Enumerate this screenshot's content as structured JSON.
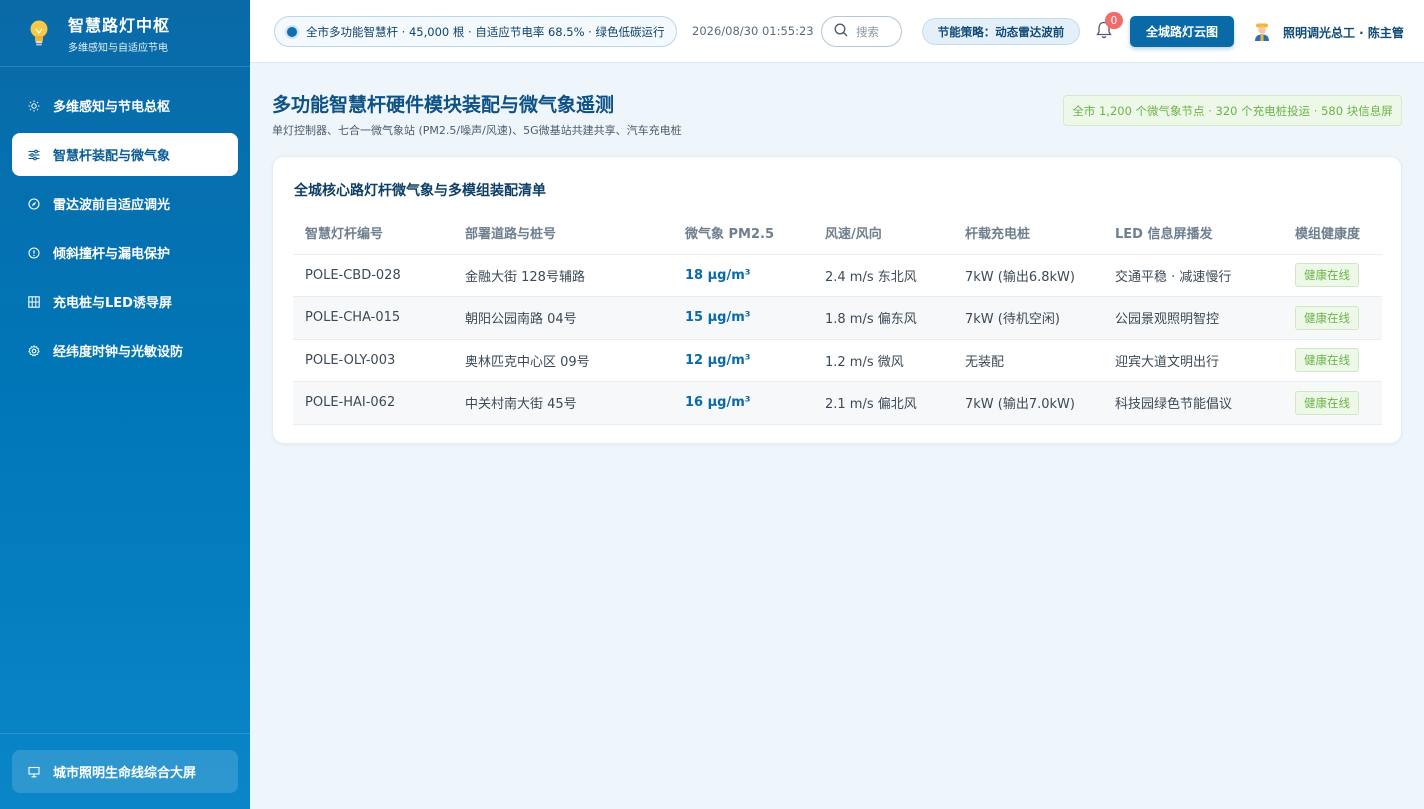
{
  "sidebar": {
    "brand_title": "智慧路灯中枢",
    "brand_subtitle": "多维感知与自适应节电",
    "items": [
      {
        "label": "多维感知与节电总枢",
        "icon": "sun-icon"
      },
      {
        "label": "智慧杆装配与微气象",
        "icon": "sliders-icon",
        "active": true
      },
      {
        "label": "雷达波前自适应调光",
        "icon": "compass-icon"
      },
      {
        "label": "倾斜撞杆与漏电保护",
        "icon": "alert-circle-icon"
      },
      {
        "label": "充电桩与LED诱导屏",
        "icon": "grid-icon"
      },
      {
        "label": "经纬度时钟与光敏设防",
        "icon": "gear-icon"
      }
    ],
    "footer_label": "城市照明生命线综合大屏"
  },
  "header": {
    "ticker": "全市多功能智慧杆 · 45,000 根 · 自适应节电率 68.5% · 绿色低碳运行",
    "datetime": "2026/08/30 01:55:23",
    "search_placeholder": "搜索",
    "policy": "节能策略：动态雷达波前",
    "notification_count": "0",
    "cloud_button": "全城路灯云图",
    "user": "照明调光总工 · 陈主管"
  },
  "page": {
    "title": "多功能智慧杆硬件模块装配与微气象遥测",
    "subtitle": "单灯控制器、七合一微气象站 (PM2.5/噪声/风速)、5G微基站共建共享、汽车充电桩",
    "stat_pill": "全市 1,200 个微气象节点 · 320 个充电桩投运 · 580 块信息屏"
  },
  "table": {
    "title": "全城核心路灯杆微气象与多模组装配清单",
    "headers": [
      "智慧灯杆编号",
      "部署道路与桩号",
      "微气象 PM2.5",
      "风速/风向",
      "杆载充电桩",
      "LED 信息屏播发",
      "模组健康度"
    ],
    "rows": [
      {
        "id": "POLE-CBD-028",
        "road": "金融大街 128号辅路",
        "pm": "18 μg/m³",
        "wind": "2.4 m/s 东北风",
        "charger": "7kW (输出6.8kW)",
        "led": "交通平稳 · 减速慢行",
        "health": "健康在线"
      },
      {
        "id": "POLE-CHA-015",
        "road": "朝阳公园南路 04号",
        "pm": "15 μg/m³",
        "wind": "1.8 m/s 偏东风",
        "charger": "7kW (待机空闲)",
        "led": "公园景观照明智控",
        "health": "健康在线"
      },
      {
        "id": "POLE-OLY-003",
        "road": "奥林匹克中心区 09号",
        "pm": "12 μg/m³",
        "wind": "1.2 m/s 微风",
        "charger": "无装配",
        "led": "迎宾大道文明出行",
        "health": "健康在线"
      },
      {
        "id": "POLE-HAI-062",
        "road": "中关村南大街 45号",
        "pm": "16 μg/m³",
        "wind": "2.1 m/s 偏北风",
        "charger": "7kW (输出7.0kW)",
        "led": "科技园绿色节能倡议",
        "health": "健康在线"
      }
    ]
  },
  "colors": {
    "primary": "#0a6aa8",
    "success": "#6cb34a",
    "badge": "#f06b6b"
  }
}
